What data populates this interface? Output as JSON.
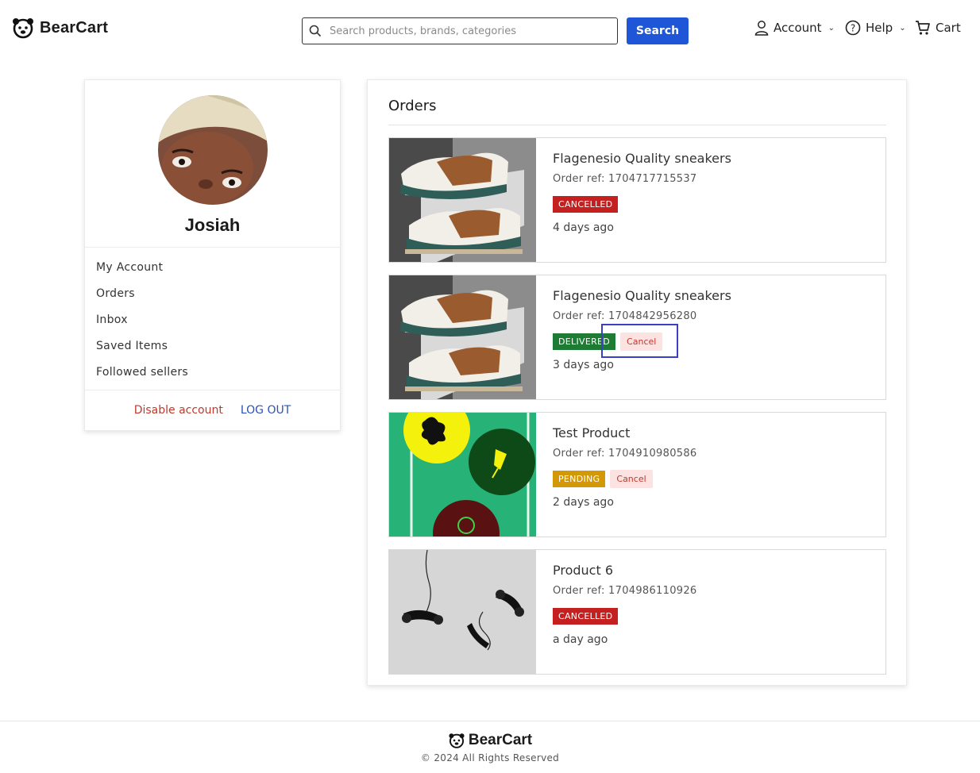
{
  "brand": {
    "name": "BearCart"
  },
  "search": {
    "placeholder": "Search products, brands, categories",
    "button_label": "Search"
  },
  "nav": {
    "account_label": "Account",
    "help_label": "Help",
    "cart_label": "Cart"
  },
  "profile": {
    "name": "Josiah",
    "menu": [
      "My Account",
      "Orders",
      "Inbox",
      "Saved Items",
      "Followed sellers"
    ],
    "disable_label": "Disable account",
    "logout_label": "LOG OUT"
  },
  "orders": {
    "title": "Orders",
    "items": [
      {
        "name": "Flagenesio Quality sneakers",
        "ref": "Order ref: 1704717715537",
        "status": "CANCELLED",
        "time": "4 days ago",
        "cancel_label": ""
      },
      {
        "name": "Flagenesio Quality sneakers",
        "ref": "Order ref: 1704842956280",
        "status": "DELIVERED",
        "time": "3 days ago",
        "cancel_label": "Cancel"
      },
      {
        "name": "Test Product",
        "ref": "Order ref: 1704910980586",
        "status": "PENDING",
        "time": "2 days ago",
        "cancel_label": "Cancel"
      },
      {
        "name": "Product 6",
        "ref": "Order ref: 1704986110926",
        "status": "CANCELLED",
        "time": "a day ago",
        "cancel_label": ""
      }
    ]
  },
  "colors": {
    "primary": "#1f56d8",
    "cancelled": "#c3201f",
    "delivered": "#1e7b34",
    "pending": "#d39806"
  },
  "footer": {
    "brand": "BearCart",
    "copyright": "© 2024 All Rights Reserved"
  }
}
